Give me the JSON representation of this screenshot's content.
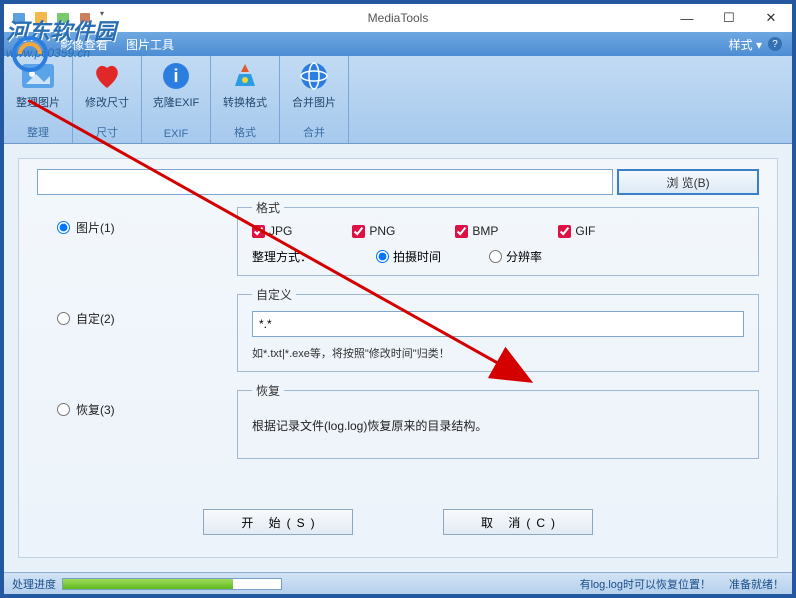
{
  "window": {
    "title": "MediaTools"
  },
  "menubar": {
    "items": [
      "影像查看",
      "图片工具"
    ],
    "style_label": "样式"
  },
  "ribbon": {
    "groups": [
      {
        "btn_label": "整理图片",
        "group_label": "整理"
      },
      {
        "btn_label": "修改尺寸",
        "group_label": "尺寸"
      },
      {
        "btn_label": "克隆EXIF",
        "group_label": "EXIF"
      },
      {
        "btn_label": "转换格式",
        "group_label": "格式"
      },
      {
        "btn_label": "合并图片",
        "group_label": "合并"
      }
    ]
  },
  "path": {
    "value": "",
    "browse_label": "浏 览(B)"
  },
  "modes": {
    "image": "图片(1)",
    "custom": "自定(2)",
    "restore": "恢复(3)"
  },
  "format_group": {
    "legend": "格式",
    "jpg": "JPG",
    "png": "PNG",
    "bmp": "BMP",
    "gif": "GIF",
    "sort_label": "整理方式：",
    "by_time": "拍摄时间",
    "by_resolution": "分辨率"
  },
  "custom_group": {
    "legend": "自定义",
    "value": "*.*",
    "hint": "如*.txt|*.exe等，将按照\"修改时间\"归类！"
  },
  "restore_group": {
    "legend": "恢复",
    "text": "根据记录文件(log.log)恢复原来的目录结构。"
  },
  "buttons": {
    "start": "开 始(S)",
    "cancel": "取 消(C)"
  },
  "status": {
    "progress_label": "处理进度",
    "progress_pct": 78,
    "log_hint": "有log.log时可以恢复位置！",
    "ready": "准备就绪！"
  },
  "watermark": {
    "text": "河东软件园",
    "url": "www.pc0359.cn"
  }
}
